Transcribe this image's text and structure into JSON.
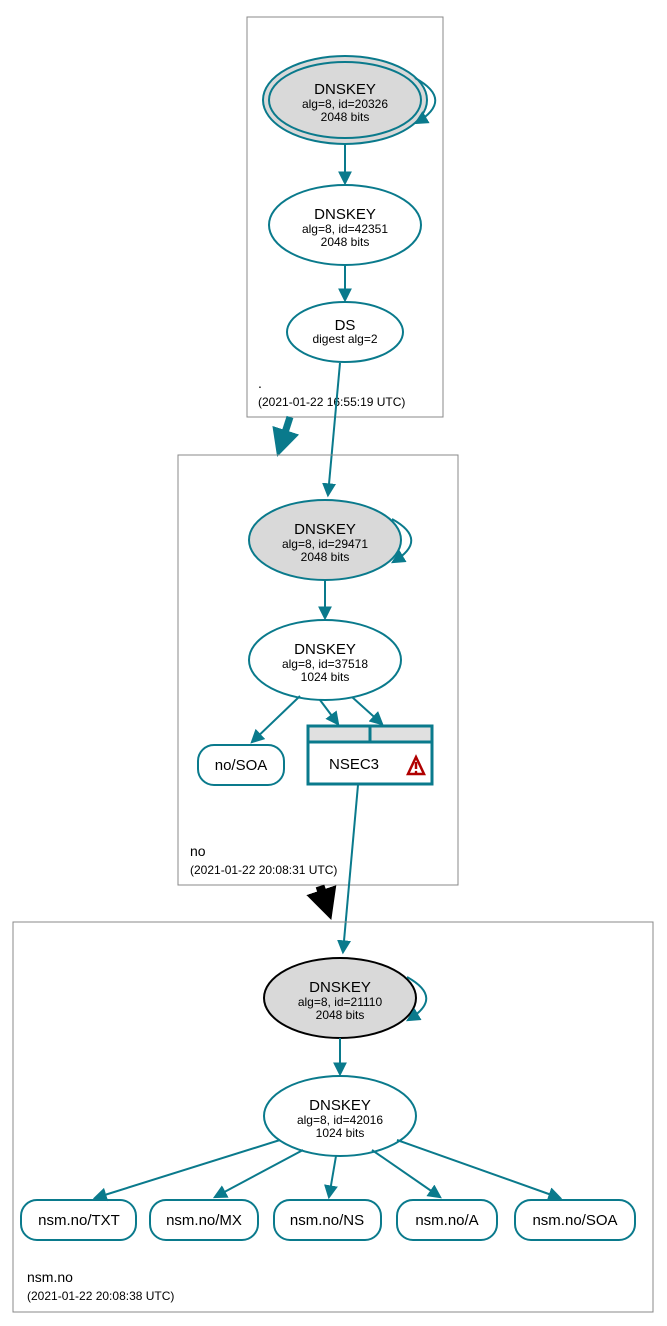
{
  "zone1": {
    "name": ".",
    "timestamp": "(2021-01-22 16:55:19 UTC)",
    "ksk": {
      "title": "DNSKEY",
      "sub1": "alg=8, id=20326",
      "sub2": "2048 bits"
    },
    "zsk": {
      "title": "DNSKEY",
      "sub1": "alg=8, id=42351",
      "sub2": "2048 bits"
    },
    "ds": {
      "title": "DS",
      "sub1": "digest alg=2"
    }
  },
  "zone2": {
    "name": "no",
    "timestamp": "(2021-01-22 20:08:31 UTC)",
    "ksk": {
      "title": "DNSKEY",
      "sub1": "alg=8, id=29471",
      "sub2": "2048 bits"
    },
    "zsk": {
      "title": "DNSKEY",
      "sub1": "alg=8, id=37518",
      "sub2": "1024 bits"
    },
    "left_rr": "no/SOA",
    "nsec3": "NSEC3"
  },
  "zone3": {
    "name": "nsm.no",
    "timestamp": "(2021-01-22 20:08:38 UTC)",
    "ksk": {
      "title": "DNSKEY",
      "sub1": "alg=8, id=21110",
      "sub2": "2048 bits"
    },
    "zsk": {
      "title": "DNSKEY",
      "sub1": "alg=8, id=42016",
      "sub2": "1024 bits"
    },
    "rr1": "nsm.no/TXT",
    "rr2": "nsm.no/MX",
    "rr3": "nsm.no/NS",
    "rr4": "nsm.no/A",
    "rr5": "nsm.no/SOA"
  }
}
